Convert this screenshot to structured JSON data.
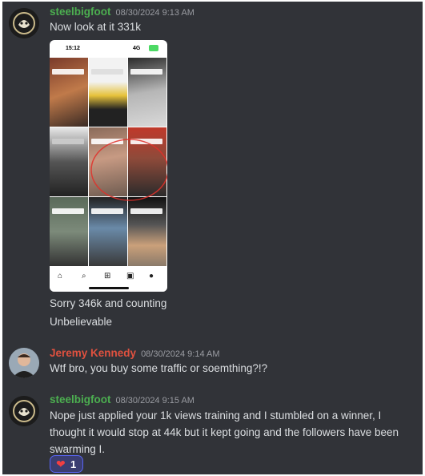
{
  "messages": [
    {
      "username": "steelbigfoot",
      "timestamp": "08/30/2024 9:13 AM",
      "name_color": "#4caf50",
      "lines": [
        "Now look at it 331k"
      ],
      "attachment": {
        "status_time": "15:12",
        "signal_text": "4G",
        "bottom_nav_icons": [
          "home-icon",
          "search-icon",
          "add-icon",
          "inbox-icon",
          "profile-icon"
        ]
      }
    },
    {
      "lines": [
        "Sorry 346k and counting",
        "Unbelievable"
      ]
    },
    {
      "username": "Jeremy Kennedy",
      "timestamp": "08/30/2024 9:14 AM",
      "name_color": "#e0513f",
      "lines": [
        "Wtf bro, you buy some traffic or soemthing?!?"
      ]
    },
    {
      "username": "steelbigfoot",
      "timestamp": "08/30/2024 9:15 AM",
      "name_color": "#4caf50",
      "lines": [
        "Nope just applied your 1k views training and I stumbled on a winner, I",
        "thought it would stop at 44k but it kept going and the followers have been",
        "swarming I."
      ],
      "reaction": {
        "emoji": "❤",
        "count": "1"
      }
    }
  ]
}
